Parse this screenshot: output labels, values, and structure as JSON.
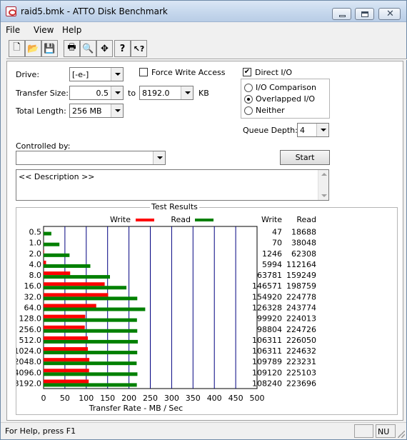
{
  "window": {
    "title": "raid5.bmk - ATTO Disk Benchmark"
  },
  "menu": [
    "File",
    "View",
    "Help"
  ],
  "toolbar": {
    "buttons": [
      {
        "name": "new-icon",
        "glyph": "🗋"
      },
      {
        "name": "open-icon",
        "glyph": "📂"
      },
      {
        "name": "save-icon",
        "glyph": "💾"
      },
      {
        "name": "print-icon",
        "glyph": "🖶"
      },
      {
        "name": "print-preview-icon",
        "glyph": "🔍"
      },
      {
        "name": "move-icon",
        "glyph": "✥"
      },
      {
        "name": "help-icon",
        "glyph": "?"
      },
      {
        "name": "context-help-icon",
        "glyph": "↖?"
      }
    ]
  },
  "form": {
    "drive_label": "Drive:",
    "drive_value": "[-e-]",
    "transfer_size_label": "Transfer Size:",
    "transfer_from": "0.5",
    "to_label": "to",
    "transfer_to": "8192.0",
    "kb_label": "KB",
    "total_length_label": "Total Length:",
    "total_length_value": "256 MB",
    "force_write_label": "Force Write Access",
    "force_write_checked": false,
    "direct_io_label": "Direct I/O",
    "direct_io_checked": true,
    "io_options": [
      "I/O Comparison",
      "Overlapped I/O",
      "Neither"
    ],
    "io_selected": 1,
    "queue_depth_label": "Queue Depth:",
    "queue_depth_value": "4",
    "controlled_by_label": "Controlled by:",
    "controlled_by_value": "",
    "start_label": "Start",
    "description": "<< Description >>"
  },
  "results": {
    "title": "Test Results",
    "legend_write": "Write",
    "legend_read": "Read",
    "col_write": "Write",
    "col_read": "Read",
    "write_color": "#ff0000",
    "read_color": "#008000"
  },
  "chart_data": {
    "type": "bar",
    "orientation": "horizontal",
    "title": "Test Results",
    "xlabel": "Transfer Rate - MB / Sec",
    "xlim": [
      0,
      500
    ],
    "xticks": [
      "0",
      "50",
      "100",
      "150",
      "200",
      "250",
      "300",
      "350",
      "400",
      "450",
      "500"
    ],
    "categories": [
      "0.5",
      "1.0",
      "2.0",
      "4.0",
      "8.0",
      "16.0",
      "32.0",
      "64.0",
      "128.0",
      "256.0",
      "512.0",
      "1024.0",
      "2048.0",
      "4096.0",
      "8192.0"
    ],
    "series": [
      {
        "name": "Write",
        "color": "#ff0000",
        "values": [
          47,
          70,
          1246,
          5994,
          63781,
          146571,
          154920,
          126328,
          99920,
          98804,
          106311,
          106311,
          109789,
          109120,
          108240
        ]
      },
      {
        "name": "Read",
        "color": "#008000",
        "values": [
          18688,
          38048,
          62308,
          112164,
          159249,
          198759,
          224778,
          243774,
          224013,
          224726,
          226050,
          224632,
          223231,
          225103,
          223696
        ]
      }
    ],
    "grid": true,
    "legend": "top"
  },
  "status": {
    "text": "For Help, press F1",
    "indicator": "NU"
  }
}
